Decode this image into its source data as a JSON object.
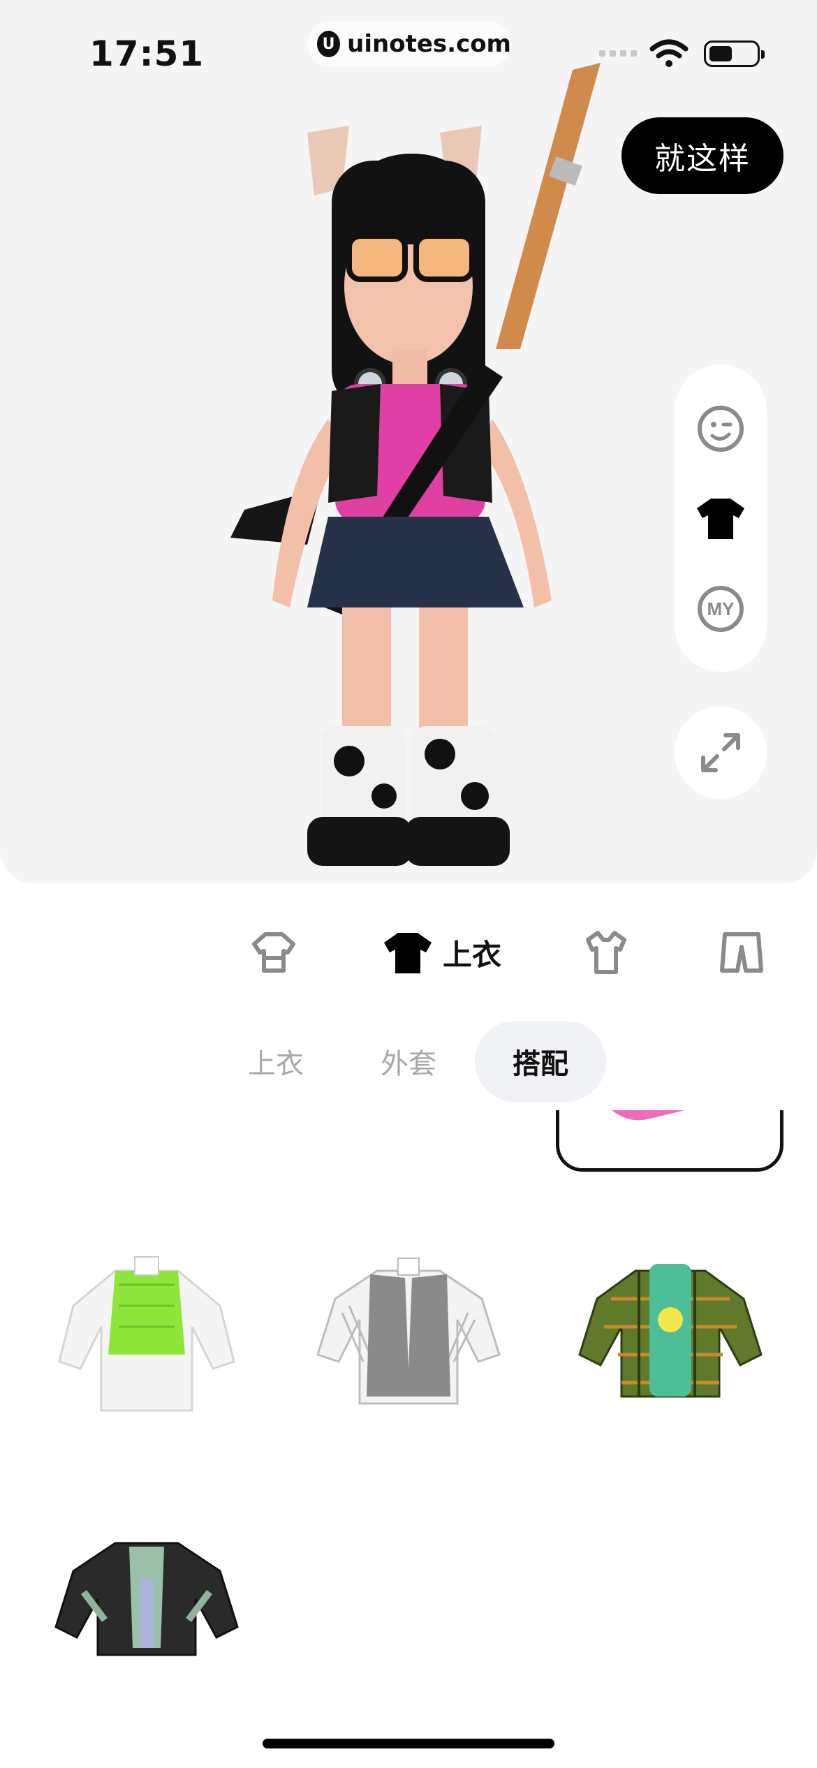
{
  "status_bar": {
    "time": "17:51",
    "url": "uinotes.com",
    "logo_letter": "U"
  },
  "header": {
    "done_button": "就这样"
  },
  "side_tools": [
    {
      "name": "face-icon"
    },
    {
      "name": "top-clothes-icon"
    },
    {
      "name": "my-icon",
      "label": "MY"
    }
  ],
  "categories": [
    {
      "icon": "suit-icon",
      "label": ""
    },
    {
      "icon": "shirt-icon",
      "label": "上衣",
      "active": true
    },
    {
      "icon": "dress-icon",
      "label": ""
    },
    {
      "icon": "pants-icon",
      "label": ""
    }
  ],
  "sub_tabs": [
    {
      "label": "上衣"
    },
    {
      "label": "外套"
    },
    {
      "label": "搭配",
      "active": true
    }
  ],
  "items": [
    {
      "name": "green-vest-white-shirt"
    },
    {
      "name": "grey-vest-striped-shirt"
    },
    {
      "name": "plaid-shirt-green-hoodie"
    },
    {
      "name": "black-leather-jacket"
    }
  ],
  "colors": {
    "accent": "#000000",
    "stage_bg": "#f5f5f5",
    "inactive_text": "#a8a8a8",
    "tab_active_bg": "#f1f2f6"
  }
}
